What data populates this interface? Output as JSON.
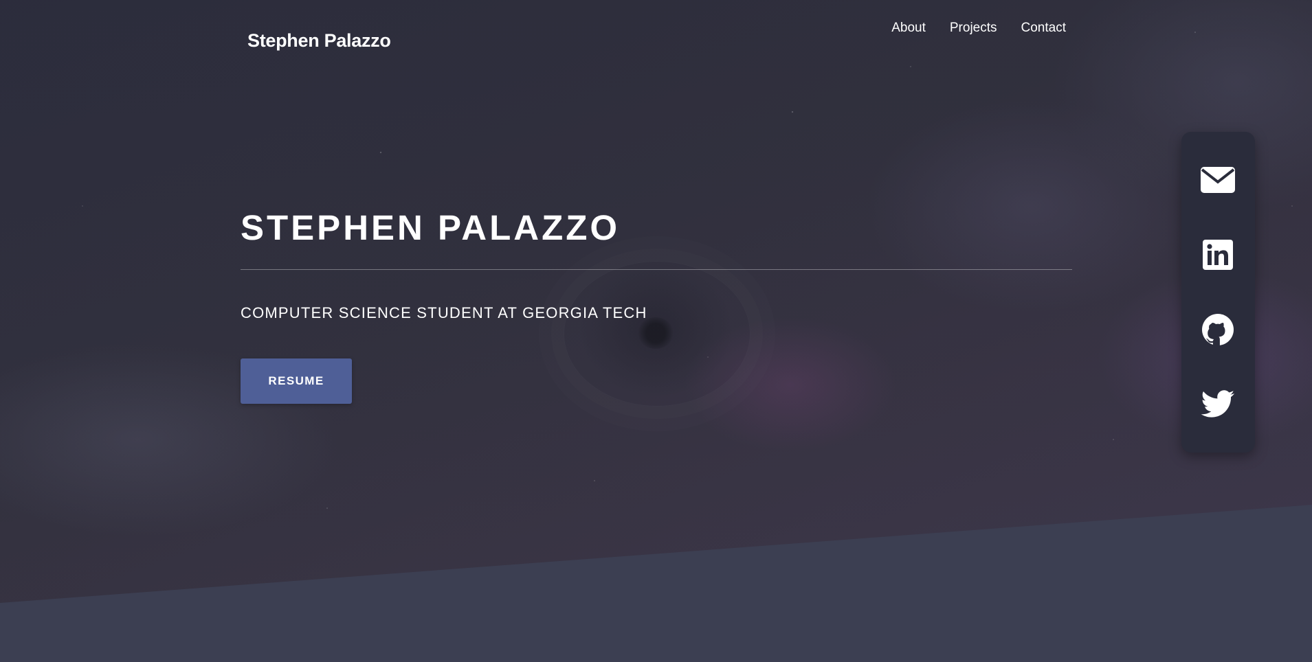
{
  "header": {
    "brand": "Stephen Palazzo",
    "nav": [
      {
        "label": "About"
      },
      {
        "label": "Projects"
      },
      {
        "label": "Contact"
      }
    ]
  },
  "hero": {
    "title": "STEPHEN PALAZZO",
    "subtitle": "COMPUTER SCIENCE STUDENT AT GEORGIA TECH",
    "resume_label": "RESUME"
  },
  "social": {
    "icons": [
      "envelope-icon",
      "linkedin-icon",
      "github-icon",
      "twitter-icon"
    ]
  },
  "colors": {
    "background": "#3c3f52",
    "hero_dark": "#2d2e3e",
    "accent_button": "#4f5f97",
    "sidebar": "#2a2c3b",
    "text": "#ffffff"
  }
}
